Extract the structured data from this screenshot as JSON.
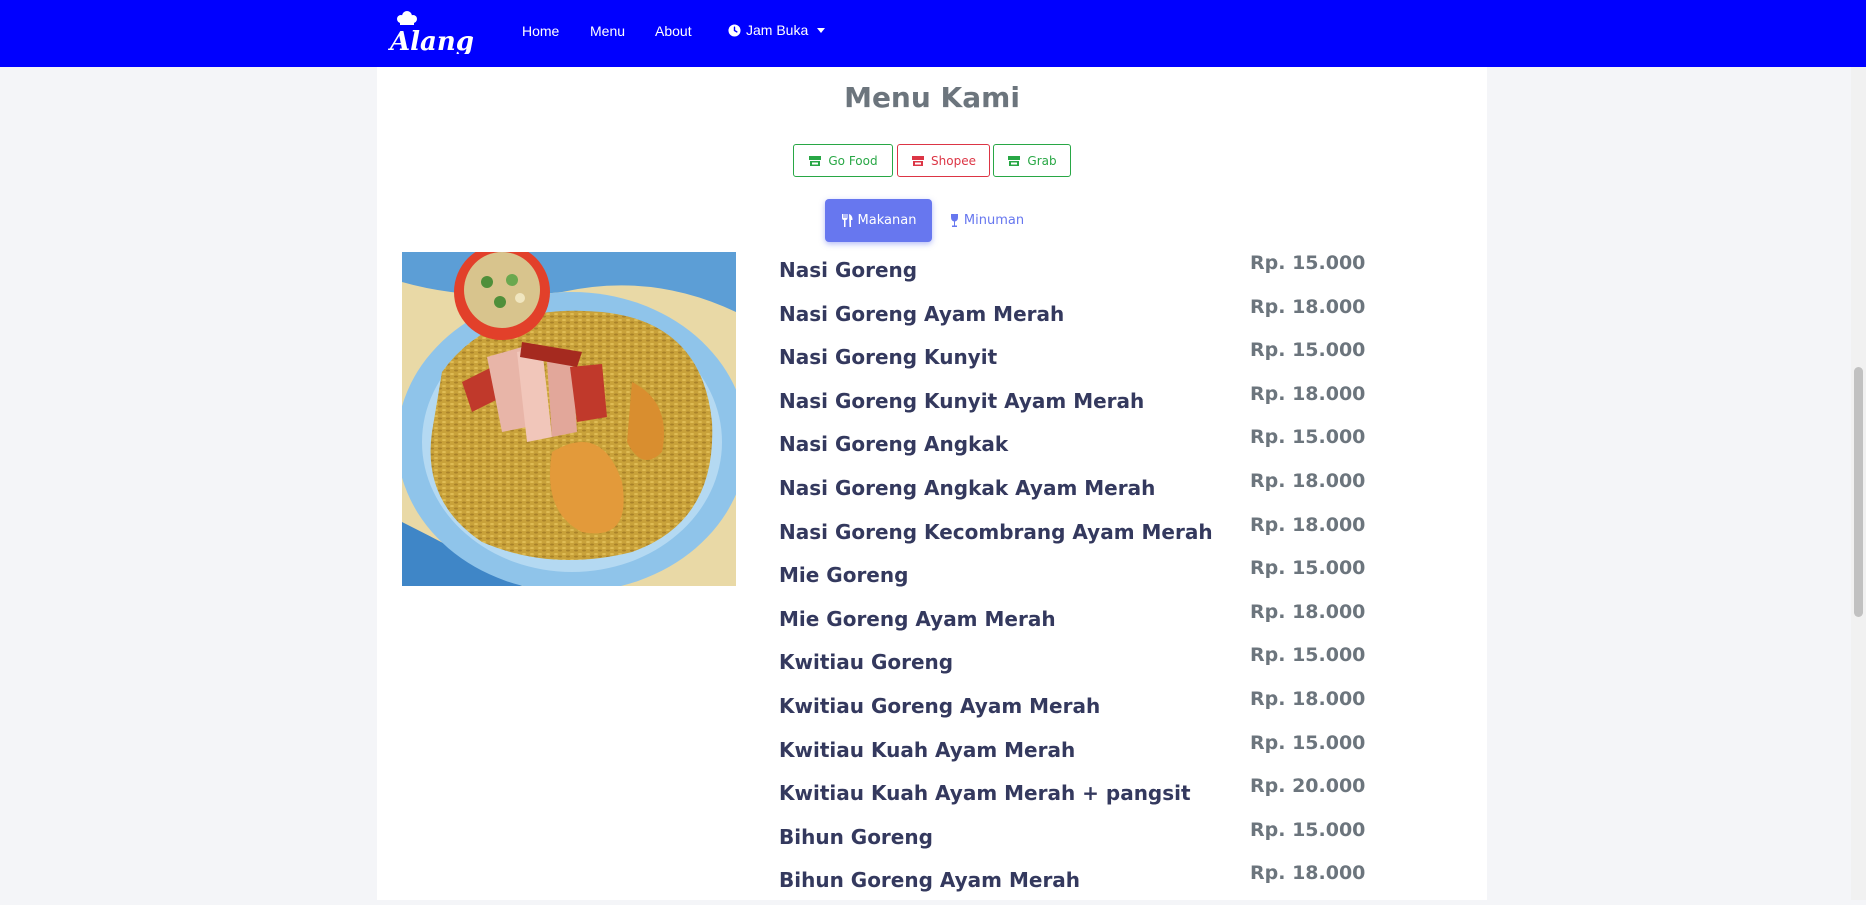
{
  "navbar": {
    "brand": "Alang",
    "links": [
      {
        "label": "Home"
      },
      {
        "label": "Menu"
      },
      {
        "label": "About"
      }
    ],
    "hours_dropdown": {
      "label": "Jam Buka"
    },
    "background": "#0000ff"
  },
  "main": {
    "title": "Menu Kami",
    "order_buttons": [
      {
        "label": "Go Food",
        "color": "#28a745",
        "icon": "store-icon"
      },
      {
        "label": "Shopee",
        "color": "#dc3545",
        "icon": "store-icon"
      },
      {
        "label": "Grab",
        "color": "#28a745",
        "icon": "store-icon"
      }
    ],
    "categories": [
      {
        "label": "Makanan",
        "icon": "utensils-icon",
        "active": true
      },
      {
        "label": "Minuman",
        "icon": "wine-glass-icon",
        "active": false
      }
    ],
    "image": {
      "subject": "fried rice with red roasted chicken slices and pickles"
    },
    "menu_items": [
      {
        "name": "Nasi Goreng",
        "price": "Rp. 15.000"
      },
      {
        "name": "Nasi Goreng Ayam Merah",
        "price": "Rp. 18.000"
      },
      {
        "name": "Nasi Goreng Kunyit",
        "price": "Rp. 15.000"
      },
      {
        "name": "Nasi Goreng Kunyit Ayam Merah",
        "price": "Rp. 18.000"
      },
      {
        "name": "Nasi Goreng Angkak",
        "price": "Rp. 15.000"
      },
      {
        "name": "Nasi Goreng Angkak Ayam Merah",
        "price": "Rp. 18.000"
      },
      {
        "name": "Nasi Goreng Kecombrang Ayam Merah",
        "price": "Rp. 18.000"
      },
      {
        "name": "Mie Goreng",
        "price": "Rp. 15.000"
      },
      {
        "name": "Mie Goreng Ayam Merah",
        "price": "Rp. 18.000"
      },
      {
        "name": "Kwitiau Goreng",
        "price": "Rp. 15.000"
      },
      {
        "name": "Kwitiau Goreng Ayam Merah",
        "price": "Rp. 18.000"
      },
      {
        "name": "Kwitiau Kuah Ayam Merah",
        "price": "Rp. 15.000"
      },
      {
        "name": "Kwitiau Kuah Ayam Merah + pangsit",
        "price": "Rp. 20.000"
      },
      {
        "name": "Bihun Goreng",
        "price": "Rp. 15.000"
      },
      {
        "name": "Bihun Goreng Ayam Merah",
        "price": "Rp. 18.000"
      }
    ]
  }
}
